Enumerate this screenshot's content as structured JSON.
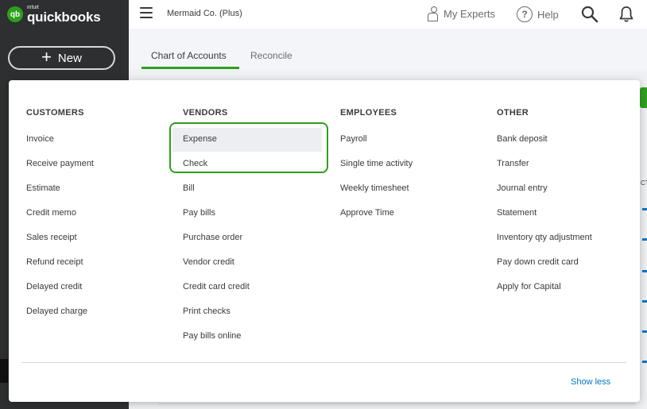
{
  "brand": {
    "mark": "qb",
    "intuit": "intuit",
    "name": "quickbooks"
  },
  "sidebar": {
    "new_label": "New"
  },
  "topbar": {
    "company": "Mermaid Co. (Plus)",
    "my_experts": "My Experts",
    "help": "Help",
    "help_glyph": "?"
  },
  "tabs": [
    {
      "label": "Chart of Accounts",
      "active": true
    },
    {
      "label": "Reconcile",
      "active": false
    }
  ],
  "menu": {
    "columns": [
      {
        "header": "CUSTOMERS",
        "items": [
          "Invoice",
          "Receive payment",
          "Estimate",
          "Credit memo",
          "Sales receipt",
          "Refund receipt",
          "Delayed credit",
          "Delayed charge"
        ]
      },
      {
        "header": "VENDORS",
        "items": [
          "Expense",
          "Check",
          "Bill",
          "Pay bills",
          "Purchase order",
          "Vendor credit",
          "Credit card credit",
          "Print checks",
          "Pay bills online"
        ],
        "selected": "Expense"
      },
      {
        "header": "EMPLOYEES",
        "items": [
          "Payroll",
          "Single time activity",
          "Weekly timesheet",
          "Approve Time"
        ]
      },
      {
        "header": "OTHER",
        "items": [
          "Bank deposit",
          "Transfer",
          "Journal entry",
          "Statement",
          "Inventory qty adjustment",
          "Pay down credit card",
          "Apply for Capital"
        ]
      }
    ],
    "show_less": "Show less"
  },
  "background": {
    "column_fragment": "CT"
  },
  "colors": {
    "accent": "#2ca01c",
    "link": "#0077c5",
    "sidebar": "#2e2f30"
  },
  "icons": [
    "hamburger-menu-icon",
    "person-icon",
    "help-icon",
    "search-icon",
    "bell-icon",
    "plus-icon"
  ]
}
